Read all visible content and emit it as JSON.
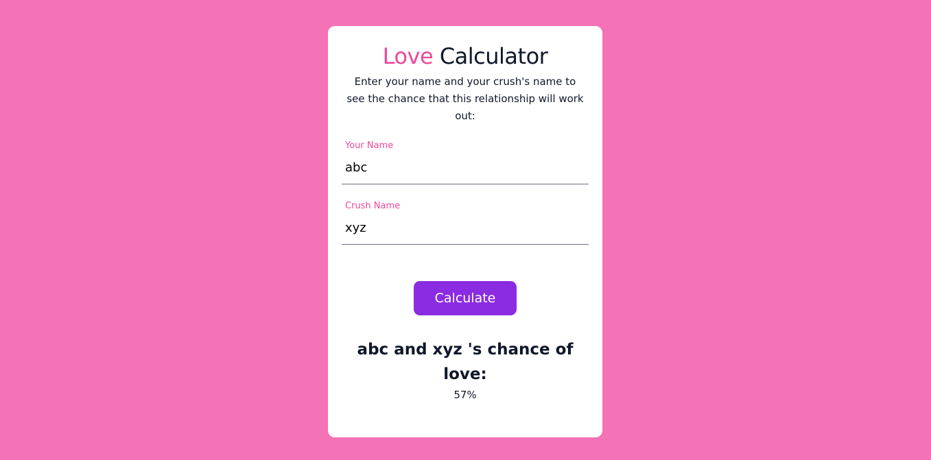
{
  "title": {
    "accent": "Love",
    "rest": "Calculator"
  },
  "subtitle": "Enter your name and your crush's name to see the chance that this relationship will work out:",
  "form": {
    "your_name_label": "Your Name",
    "your_name_value": "abc",
    "crush_name_label": "Crush Name",
    "crush_name_value": "xyz",
    "calculate_label": "Calculate"
  },
  "result": {
    "heading": "abc and xyz 's chance of love:",
    "value": "57%"
  },
  "colors": {
    "background": "#f472b6",
    "accent": "#ec4899",
    "button": "#8b2be2",
    "text": "#0f172a"
  }
}
